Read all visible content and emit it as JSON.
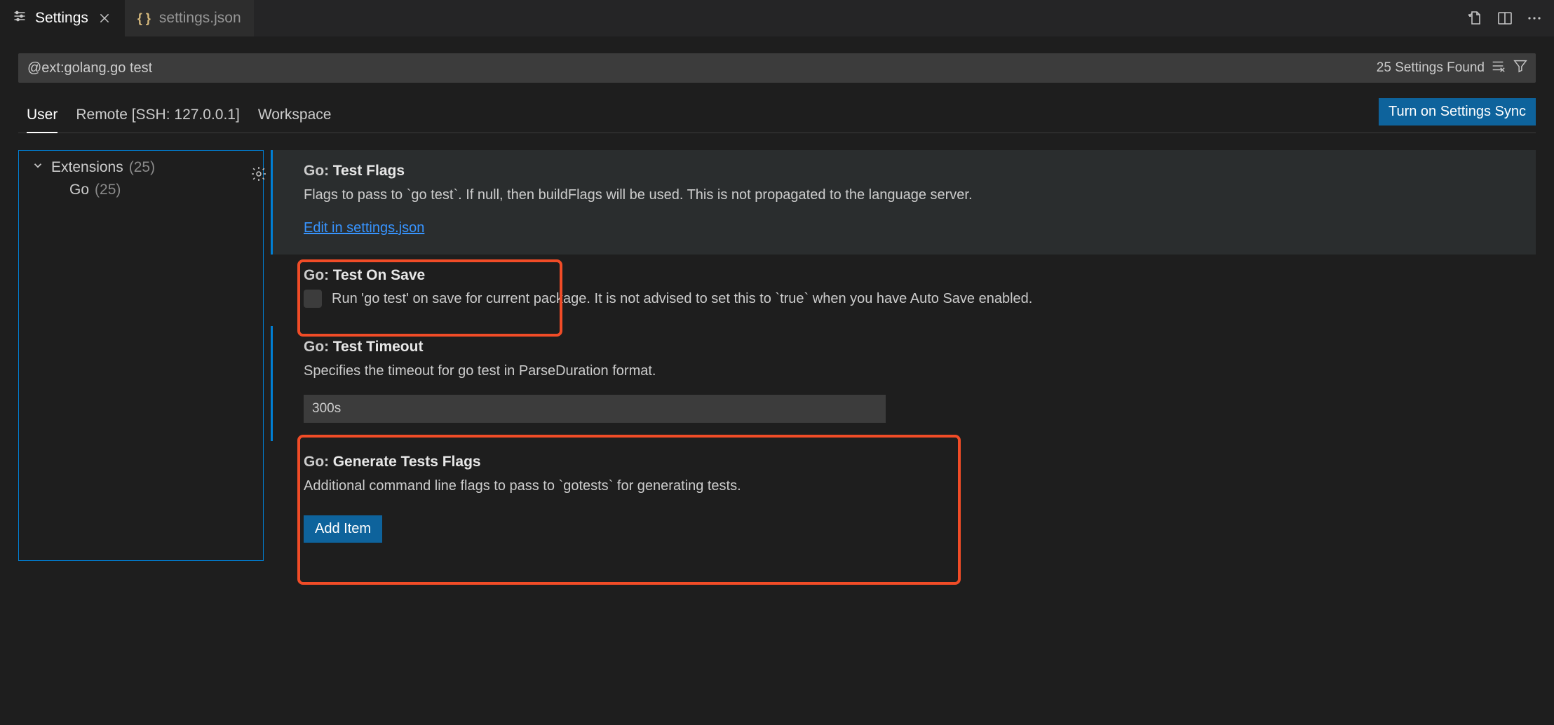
{
  "tabs": {
    "settings_label": "Settings",
    "json_label": "settings.json"
  },
  "search": {
    "value": "@ext:golang.go test",
    "found": "25 Settings Found"
  },
  "scopes": {
    "user": "User",
    "remote": "Remote [SSH: 127.0.0.1]",
    "workspace": "Workspace"
  },
  "sync_button": "Turn on Settings Sync",
  "tree": {
    "extensions_label": "Extensions",
    "extensions_count": "(25)",
    "go_label": "Go",
    "go_count": "(25)"
  },
  "settings": {
    "cat_prefix": "Go:",
    "test_flags": {
      "name": "Test Flags",
      "desc": "Flags to pass to `go test`. If null, then buildFlags will be used. This is not propagated to the language server.",
      "edit_link": "Edit in settings.json"
    },
    "test_on_save": {
      "name": "Test On Save",
      "desc": "Run 'go test' on save for current package. It is not advised to set this to `true` when you have Auto Save enabled."
    },
    "test_timeout": {
      "name": "Test Timeout",
      "desc": "Specifies the timeout for go test in ParseDuration format.",
      "value": "300s"
    },
    "generate_tests_flags": {
      "name": "Generate Tests Flags",
      "desc": "Additional command line flags to pass to `gotests` for generating tests.",
      "add_item": "Add Item"
    }
  }
}
